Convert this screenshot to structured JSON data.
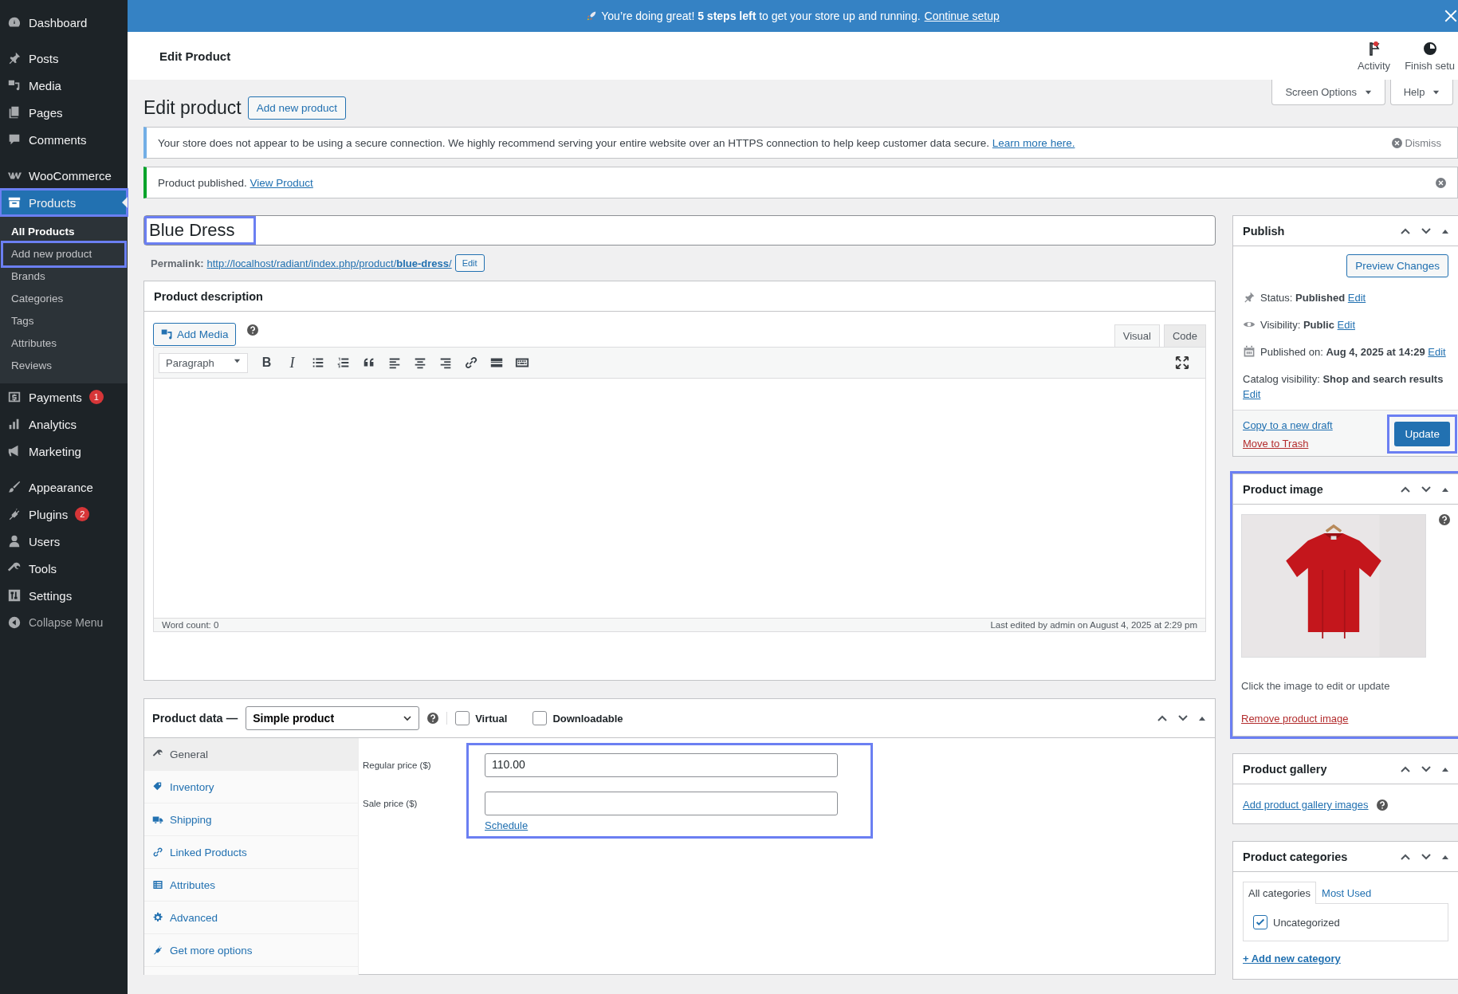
{
  "sidebar": {
    "groups": [
      {
        "items": [
          {
            "label": "Dashboard",
            "kind": "dashboard",
            "selected": false,
            "highlighted": false
          }
        ]
      },
      {
        "items": [
          {
            "label": "Posts",
            "kind": "pin",
            "selected": false,
            "highlighted": false
          },
          {
            "label": "Media",
            "kind": "media",
            "selected": false,
            "highlighted": false
          },
          {
            "label": "Pages",
            "kind": "pages",
            "selected": false,
            "highlighted": false
          },
          {
            "label": "Comments",
            "kind": "comment",
            "selected": false,
            "highlighted": false
          }
        ]
      },
      {
        "items": [
          {
            "label": "WooCommerce",
            "kind": "woo",
            "selected": false,
            "highlighted": false
          },
          {
            "label": "Products",
            "kind": "archive",
            "selected": true,
            "highlighted": true,
            "children": [
              {
                "label": "All Products",
                "selected": true,
                "highlighted": false
              },
              {
                "label": "Add new product",
                "selected": false,
                "highlighted": true
              },
              {
                "label": "Brands",
                "selected": false,
                "highlighted": false
              },
              {
                "label": "Categories",
                "selected": false,
                "highlighted": false
              },
              {
                "label": "Tags",
                "selected": false,
                "highlighted": false
              },
              {
                "label": "Attributes",
                "selected": false,
                "highlighted": false
              },
              {
                "label": "Reviews",
                "selected": false,
                "highlighted": false
              }
            ]
          },
          {
            "label": "Payments",
            "kind": "dollar",
            "selected": false,
            "highlighted": false,
            "badge": "1"
          },
          {
            "label": "Analytics",
            "kind": "bars",
            "selected": false,
            "highlighted": false
          },
          {
            "label": "Marketing",
            "kind": "megaphone",
            "selected": false,
            "highlighted": false
          }
        ]
      },
      {
        "items": [
          {
            "label": "Appearance",
            "kind": "brush",
            "selected": false,
            "highlighted": false
          },
          {
            "label": "Plugins",
            "kind": "plug",
            "selected": false,
            "highlighted": false,
            "badge": "2"
          },
          {
            "label": "Users",
            "kind": "user",
            "selected": false,
            "highlighted": false
          },
          {
            "label": "Tools",
            "kind": "wrench",
            "selected": false,
            "highlighted": false
          },
          {
            "label": "Settings",
            "kind": "settings",
            "selected": false,
            "highlighted": false
          },
          {
            "label": "Collapse Menu",
            "kind": "collapse",
            "selected": false,
            "highlighted": false
          }
        ]
      }
    ]
  },
  "banner": {
    "text": "You’re doing great! **5 steps left** to get your store up and running.",
    "link": "Continue setup"
  },
  "header": {
    "title": "Edit Product",
    "actions": [
      {
        "label": "Activity",
        "kind": "flag"
      },
      {
        "label": "Finish setu",
        "kind": "progress"
      }
    ]
  },
  "screen_buttons": [
    "Screen Options",
    "Help"
  ],
  "page": {
    "title": "Edit product",
    "add_button": "Add new product"
  },
  "notices": [
    {
      "kind": "info",
      "text": "Your store does not appear to be using a secure connection. We highly recommend serving your entire website over an HTTPS connection to help keep customer data secure.",
      "link": "Learn more here.",
      "dismiss": "Dismiss"
    },
    {
      "kind": "success",
      "text": "Product published.",
      "link": "View Product"
    }
  ],
  "title_field": {
    "value": "Blue Dress",
    "highlighted": true
  },
  "permalink": {
    "label": "Permalink:",
    "url": "http://localhost/radiant/index.php/product/**blue-dress**/",
    "button": "Edit"
  },
  "description": {
    "title": "Product description",
    "add_media": "Add Media",
    "tabs": [
      {
        "label": "Visual",
        "selected": true
      },
      {
        "label": "Code",
        "selected": false
      }
    ],
    "format": "Paragraph",
    "toolbar": [
      {
        "kind": "bold",
        "label": "B"
      },
      {
        "kind": "italic",
        "label": "I"
      },
      {
        "kind": "ul"
      },
      {
        "kind": "ol"
      },
      {
        "kind": "quote"
      },
      {
        "kind": "align-left"
      },
      {
        "kind": "align-center"
      },
      {
        "kind": "align-right"
      },
      {
        "kind": "link"
      },
      {
        "kind": "more"
      },
      {
        "kind": "kitchen"
      }
    ],
    "word_count": "Word count: 0",
    "last_edited": "Last edited by admin on August 4, 2025 at 2:29 pm"
  },
  "product_data": {
    "title": "Product data —",
    "type": "Simple product",
    "options": [
      {
        "label": "Virtual",
        "checked": false
      },
      {
        "label": "Downloadable",
        "checked": false
      }
    ],
    "tabs": [
      {
        "label": "General",
        "kind": "wrench",
        "selected": true
      },
      {
        "label": "Inventory",
        "kind": "tag",
        "selected": false
      },
      {
        "label": "Shipping",
        "kind": "truck",
        "selected": false
      },
      {
        "label": "Linked Products",
        "kind": "link",
        "selected": false
      },
      {
        "label": "Attributes",
        "kind": "list",
        "selected": false
      },
      {
        "label": "Advanced",
        "kind": "gear",
        "selected": false
      },
      {
        "label": "Get more options",
        "kind": "plug",
        "selected": false
      }
    ],
    "pricing": {
      "highlighted": true,
      "fields": [
        {
          "label": "Regular price ($)",
          "value": "110.00"
        },
        {
          "label": "Sale price ($)"
        }
      ],
      "link": "Schedule"
    }
  },
  "publish": {
    "title": "Publish",
    "preview": "Preview Changes",
    "rows": [
      {
        "kind": "pin",
        "text": "Status: **Published**",
        "link": "Edit"
      },
      {
        "kind": "eye",
        "text": "Visibility: **Public**",
        "link": "Edit"
      },
      {
        "kind": "calendar",
        "text": "Published on: **Aug 4, 2025 at 14:29**",
        "link": "Edit"
      }
    ],
    "catalog": "Catalog visibility: **Shop and search results**",
    "catalog_link": "Edit",
    "copy": "Copy to a new draft",
    "trash": "Move to Trash",
    "update": "Update",
    "update_highlighted": true
  },
  "product_image": {
    "title": "Product image",
    "highlighted": true,
    "hint": "Click the image to edit or update",
    "remove": "Remove product image"
  },
  "gallery": {
    "title": "Product gallery",
    "link": "Add product gallery images"
  },
  "categories": {
    "title": "Product categories",
    "tabs": [
      {
        "label": "All categories",
        "selected": true
      },
      {
        "label": "Most Used",
        "selected": false
      }
    ],
    "items": [
      {
        "label": "Uncategorized",
        "checked": true
      }
    ],
    "add": "+ Add new category"
  }
}
